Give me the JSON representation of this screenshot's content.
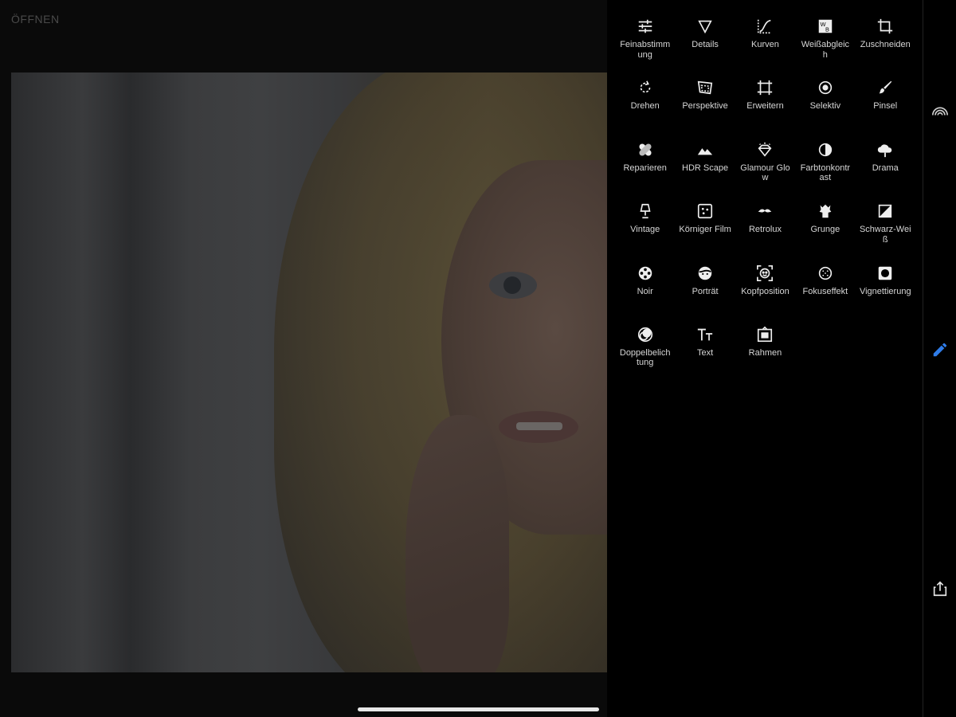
{
  "header": {
    "open_label": "ÖFFNEN"
  },
  "tools": [
    {
      "label": "Feinabstimmung",
      "icon": "sliders-icon"
    },
    {
      "label": "Details",
      "icon": "triangle-icon"
    },
    {
      "label": "Kurven",
      "icon": "curves-icon"
    },
    {
      "label": "Weißabgleich",
      "icon": "white-balance-icon"
    },
    {
      "label": "Zuschneiden",
      "icon": "crop-icon"
    },
    {
      "label": "Drehen",
      "icon": "rotate-icon"
    },
    {
      "label": "Perspektive",
      "icon": "perspective-icon"
    },
    {
      "label": "Erweitern",
      "icon": "expand-icon"
    },
    {
      "label": "Selektiv",
      "icon": "selective-icon"
    },
    {
      "label": "Pinsel",
      "icon": "brush-icon"
    },
    {
      "label": "Reparieren",
      "icon": "bandage-icon"
    },
    {
      "label": "HDR Scape",
      "icon": "mountain-icon"
    },
    {
      "label": "Glamour Glow",
      "icon": "diamond-icon"
    },
    {
      "label": "Farbtonkontrast",
      "icon": "tonal-contrast-icon"
    },
    {
      "label": "Drama",
      "icon": "cloud-icon"
    },
    {
      "label": "Vintage",
      "icon": "lamp-icon"
    },
    {
      "label": "Körniger Film",
      "icon": "grain-icon"
    },
    {
      "label": "Retrolux",
      "icon": "mustache-icon"
    },
    {
      "label": "Grunge",
      "icon": "grunge-icon"
    },
    {
      "label": "Schwarz-Weiß",
      "icon": "black-white-icon"
    },
    {
      "label": "Noir",
      "icon": "film-reel-icon"
    },
    {
      "label": "Porträt",
      "icon": "face-icon"
    },
    {
      "label": "Kopfposition",
      "icon": "head-pose-icon"
    },
    {
      "label": "Fokuseffekt",
      "icon": "lens-blur-icon"
    },
    {
      "label": "Vignettierung",
      "icon": "vignette-icon"
    },
    {
      "label": "Doppelbelichtung",
      "icon": "double-exposure-icon"
    },
    {
      "label": "Text",
      "icon": "text-icon"
    },
    {
      "label": "Rahmen",
      "icon": "frame-icon"
    }
  ],
  "rail": {
    "looks_icon": "rainbow-icon",
    "tools_icon": "pencil-icon",
    "share_icon": "share-icon",
    "active_color": "#2f7ce8"
  }
}
